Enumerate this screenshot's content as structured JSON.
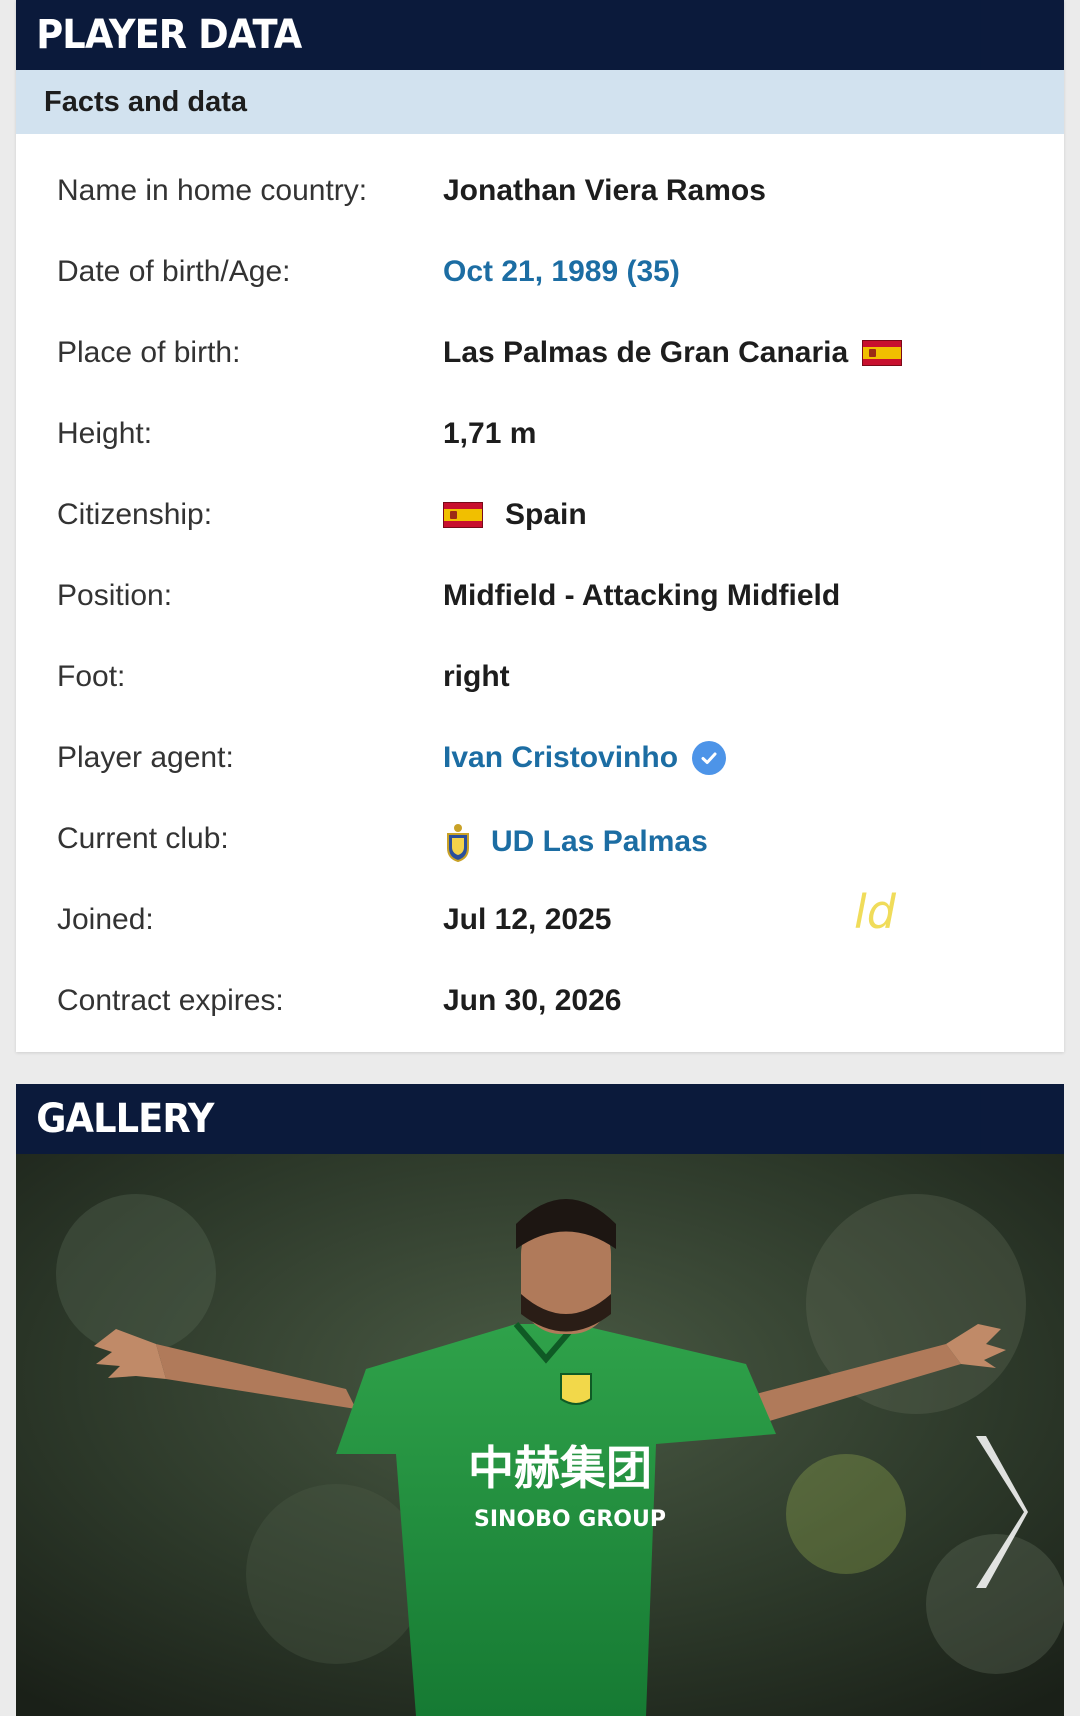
{
  "player_data": {
    "header": "PLAYER DATA",
    "subheader": "Facts and data",
    "rows": [
      {
        "label": "Name in home country:",
        "value": "Jonathan Viera Ramos"
      },
      {
        "label": "Date of birth/Age:",
        "value": "Oct 21, 1989 (35)"
      },
      {
        "label": "Place of birth:",
        "value": "Las Palmas de Gran Canaria"
      },
      {
        "label": "Height:",
        "value": "1,71 m"
      },
      {
        "label": "Citizenship:",
        "value": "Spain"
      },
      {
        "label": "Position:",
        "value": "Midfield - Attacking Midfield"
      },
      {
        "label": "Foot:",
        "value": "right"
      },
      {
        "label": "Player agent:",
        "value": "Ivan Cristovinho"
      },
      {
        "label": "Current club:",
        "value": "UD Las Palmas"
      },
      {
        "label": "Joined:",
        "value": "Jul 12, 2025"
      },
      {
        "label": "Contract expires:",
        "value": "Jun 30, 2026"
      }
    ],
    "watermark": "ld"
  },
  "gallery": {
    "header": "GALLERY",
    "jersey_text_cn": "中赫集团",
    "jersey_text_en": "SINOBO GROUP"
  },
  "icons": {
    "flag": "spain-flag-icon",
    "verified": "verified-badge-icon",
    "club": "ud-las-palmas-crest-icon",
    "next": "chevron-right-icon"
  },
  "colors": {
    "header_bg": "#0b1a3b",
    "subheader_bg": "#d2e2ef",
    "link": "#1c6da3",
    "verified": "#4d94e8",
    "page_bg": "#ebebeb"
  }
}
